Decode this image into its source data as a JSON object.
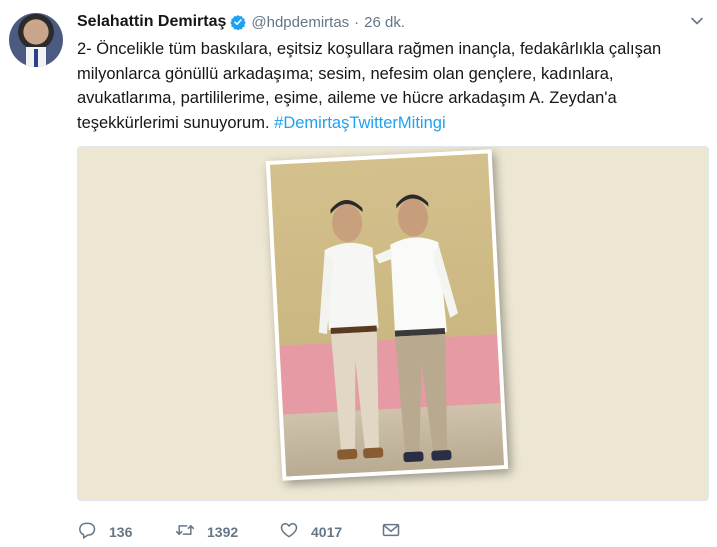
{
  "tweet": {
    "author_name": "Selahattin Demirtaş",
    "author_handle": "@hdpdemirtas",
    "separator": "·",
    "time": "26 dk.",
    "text_main": "2- Öncelikle tüm baskılara, eşitsiz koşullara rağmen inançla, fedakârlıkla çalışan milyonlarca gönüllü arkadaşıma; sesim, nefesim olan gençlere, kadınlara, avukatlarıma, partililerime, eşime, aileme ve hücre arkadaşım A. Zeydan'a teşekkürlerimi sunuyorum.",
    "hashtag": "#DemirtaşTwitterMitingi"
  },
  "actions": {
    "replies": "136",
    "retweets": "1392",
    "likes": "4017"
  },
  "icons": {
    "verified": "verified-badge-icon",
    "more": "chevron-down-icon",
    "reply": "reply-icon",
    "retweet": "retweet-icon",
    "like": "heart-icon",
    "message": "envelope-icon"
  },
  "colors": {
    "link": "#1da1f2",
    "muted": "#657786",
    "text": "#14171a"
  }
}
